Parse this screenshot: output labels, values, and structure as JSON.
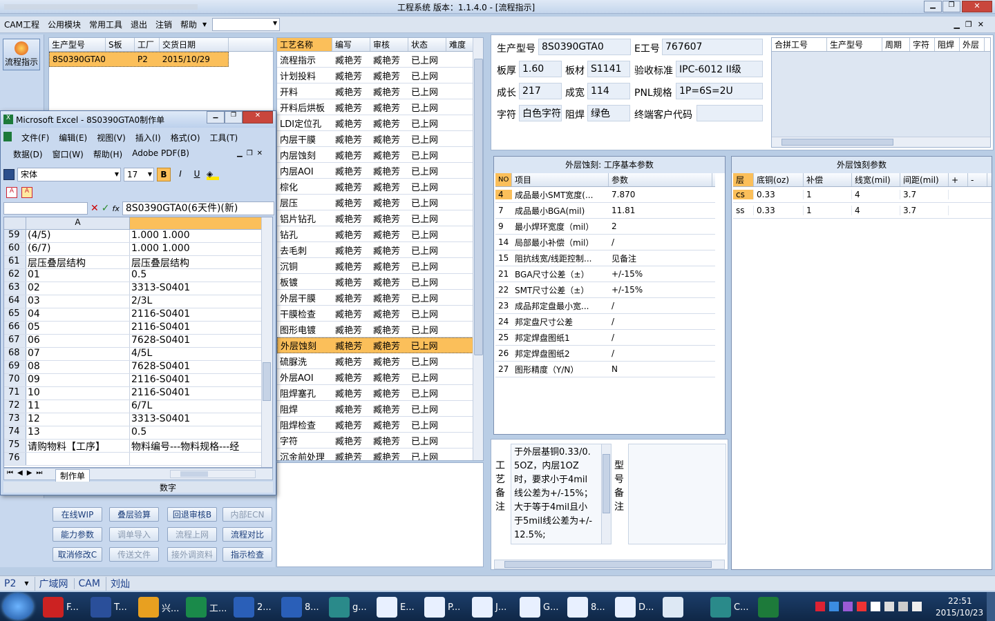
{
  "window": {
    "title": "工程系统   版本：1.1.4.0 - [流程指示]"
  },
  "menu": [
    "CAM工程",
    "公用模块",
    "常用工具",
    "退出",
    "注销",
    "帮助"
  ],
  "left_button": "流程指示",
  "order_table": {
    "headers": [
      "生产型号",
      "S板",
      "工厂",
      "交货日期"
    ],
    "row": [
      "8S0390GTA0",
      "",
      "P2",
      "2015/10/29"
    ]
  },
  "process_table": {
    "headers": [
      "工艺名称",
      "编写",
      "审核",
      "状态",
      "难度"
    ],
    "rows": [
      [
        "流程指示",
        "臧艳芳",
        "臧艳芳",
        "已上网"
      ],
      [
        "计划投料",
        "臧艳芳",
        "臧艳芳",
        "已上网"
      ],
      [
        "开料",
        "臧艳芳",
        "臧艳芳",
        "已上网"
      ],
      [
        "开料后烘板",
        "臧艳芳",
        "臧艳芳",
        "已上网"
      ],
      [
        "LDI定位孔",
        "臧艳芳",
        "臧艳芳",
        "已上网"
      ],
      [
        "内层干膜",
        "臧艳芳",
        "臧艳芳",
        "已上网"
      ],
      [
        "内层蚀刻",
        "臧艳芳",
        "臧艳芳",
        "已上网"
      ],
      [
        "内层AOI",
        "臧艳芳",
        "臧艳芳",
        "已上网"
      ],
      [
        "棕化",
        "臧艳芳",
        "臧艳芳",
        "已上网"
      ],
      [
        "层压",
        "臧艳芳",
        "臧艳芳",
        "已上网"
      ],
      [
        "铝片钻孔",
        "臧艳芳",
        "臧艳芳",
        "已上网"
      ],
      [
        "钻孔",
        "臧艳芳",
        "臧艳芳",
        "已上网"
      ],
      [
        "去毛刺",
        "臧艳芳",
        "臧艳芳",
        "已上网"
      ],
      [
        "沉铜",
        "臧艳芳",
        "臧艳芳",
        "已上网"
      ],
      [
        "板镀",
        "臧艳芳",
        "臧艳芳",
        "已上网"
      ],
      [
        "外层干膜",
        "臧艳芳",
        "臧艳芳",
        "已上网"
      ],
      [
        "干膜检查",
        "臧艳芳",
        "臧艳芳",
        "已上网"
      ],
      [
        "图形电镀",
        "臧艳芳",
        "臧艳芳",
        "已上网"
      ],
      [
        "外层蚀刻",
        "臧艳芳",
        "臧艳芳",
        "已上网"
      ],
      [
        "硫脲洗",
        "臧艳芳",
        "臧艳芳",
        "已上网"
      ],
      [
        "外层AOI",
        "臧艳芳",
        "臧艳芳",
        "已上网"
      ],
      [
        "阻焊塞孔",
        "臧艳芳",
        "臧艳芳",
        "已上网"
      ],
      [
        "阻焊",
        "臧艳芳",
        "臧艳芳",
        "已上网"
      ],
      [
        "阻焊检查",
        "臧艳芳",
        "臧艳芳",
        "已上网"
      ],
      [
        "字符",
        "臧艳芳",
        "臧艳芳",
        "已上网"
      ],
      [
        "沉金前处理",
        "臧艳芳",
        "臧艳芳",
        "已上网"
      ]
    ],
    "selected_index": 18
  },
  "buttons": [
    [
      "在线WIP",
      "叠层验算",
      "回退审核B",
      "内部ECN"
    ],
    [
      "能力参数",
      "调单导入",
      "流程上网",
      "流程对比"
    ],
    [
      "取消修改C",
      "传送文件",
      "接外调资料",
      "指示检查"
    ]
  ],
  "buttons_disabled": [
    "内部ECN",
    "调单导入",
    "流程上网",
    "传送文件",
    "接外调资料"
  ],
  "info": {
    "生产型号": "8S0390GTA0",
    "E工号": "767607",
    "板厚": "1.60",
    "板材": "S1141",
    "验收标准": "IPC-6012 II级",
    "成长": "217",
    "成宽": "114",
    "PNL规格": "1P=6S=2U",
    "字符": "白色字符",
    "阻焊": "绿色",
    "终端客户代码": ""
  },
  "combine_headers": [
    "合拼工号",
    "生产型号",
    "周期",
    "字符",
    "阻焊",
    "外层"
  ],
  "basic_params": {
    "title": "外层蚀刻: 工序基本参数",
    "headers": [
      "NO",
      "项目",
      "参数"
    ],
    "rows": [
      [
        "4",
        "成品最小SMT宽度(...",
        "7.870"
      ],
      [
        "7",
        "成品最小BGA(mil)",
        "11.81"
      ],
      [
        "9",
        "最小焊环宽度（mil）",
        "2"
      ],
      [
        "14",
        "局部最小补偿（mil）",
        "/"
      ],
      [
        "15",
        "阻抗线宽/线距控制...",
        "见备注"
      ],
      [
        "21",
        "BGA尺寸公差（±）",
        "+/-15%"
      ],
      [
        "22",
        "SMT尺寸公差（±）",
        "+/-15%"
      ],
      [
        "23",
        "成品邦定盘最小宽...",
        "/"
      ],
      [
        "24",
        "邦定盘尺寸公差",
        "/"
      ],
      [
        "25",
        "邦定焊盘图纸1",
        "/"
      ],
      [
        "26",
        "邦定焊盘图纸2",
        "/"
      ],
      [
        "27",
        "图形精度（Y/N）",
        "N"
      ]
    ]
  },
  "etch_params": {
    "title": "外层蚀刻参数",
    "headers": [
      "层",
      "底铜(oz)",
      "补偿",
      "线宽(mil)",
      "间距(mil)",
      "+",
      "-"
    ],
    "rows": [
      [
        "cs",
        "0.33",
        "1",
        "4",
        "3.7"
      ],
      [
        "ss",
        "0.33",
        "1",
        "4",
        "3.7"
      ]
    ]
  },
  "remark": {
    "label": "工艺备注",
    "text": "于外层基铜0.33/0.5OZ，内层1OZ时，要求小于4mil线公差为+/-15%；大于等于4mil且小于5mil线公差为+/-12.5%;",
    "model_label": "型号备注"
  },
  "excel": {
    "title": "Microsoft Excel - 8S0390GTA0制作单",
    "menu1": [
      "文件(F)",
      "编辑(E)",
      "视图(V)",
      "插入(I)",
      "格式(O)",
      "工具(T)"
    ],
    "menu2": [
      "数据(D)",
      "窗口(W)",
      "帮助(H)",
      "Adobe PDF(B)"
    ],
    "font": "宋体",
    "size": "17",
    "formula": "8S0390GTA0(6天件)(新)",
    "col_a": "A",
    "rows": [
      [
        "59",
        "(4/5)",
        "1.000  1.000"
      ],
      [
        "60",
        "(6/7)",
        "1.000  1.000"
      ],
      [
        "61",
        "层压叠层结构",
        "层压叠层结构"
      ],
      [
        "62",
        "01",
        "0.5"
      ],
      [
        "63",
        "02",
        "3313-S0401"
      ],
      [
        "64",
        "03",
        "2/3L"
      ],
      [
        "65",
        "04",
        "2116-S0401"
      ],
      [
        "66",
        "05",
        "2116-S0401"
      ],
      [
        "67",
        "06",
        "7628-S0401"
      ],
      [
        "68",
        "07",
        "4/5L"
      ],
      [
        "69",
        "08",
        "7628-S0401"
      ],
      [
        "70",
        "09",
        "2116-S0401"
      ],
      [
        "71",
        "10",
        "2116-S0401"
      ],
      [
        "72",
        "11",
        "6/7L"
      ],
      [
        "73",
        "12",
        "3313-S0401"
      ],
      [
        "74",
        "13",
        "0.5"
      ],
      [
        "75",
        "请购物料【工序】",
        "物料编号---物料规格---经"
      ],
      [
        "76",
        "",
        ""
      ]
    ],
    "sheet_tab": "制作单",
    "status": "数字"
  },
  "status_bar": [
    "P2",
    "广域网",
    "CAM",
    "刘灿"
  ],
  "taskbar": {
    "items": [
      "F...",
      "T...",
      "兴...",
      "工...",
      "2...",
      "8...",
      "g...",
      "E...",
      "P...",
      "J...",
      "G...",
      "8...",
      "D...",
      "",
      "C...",
      ""
    ],
    "time": "22:51",
    "date": "2015/10/23"
  },
  "colors": {
    "selected": "#fbbf5a",
    "panel": "#cfdcee",
    "title_bg": "#dbe6f4"
  }
}
